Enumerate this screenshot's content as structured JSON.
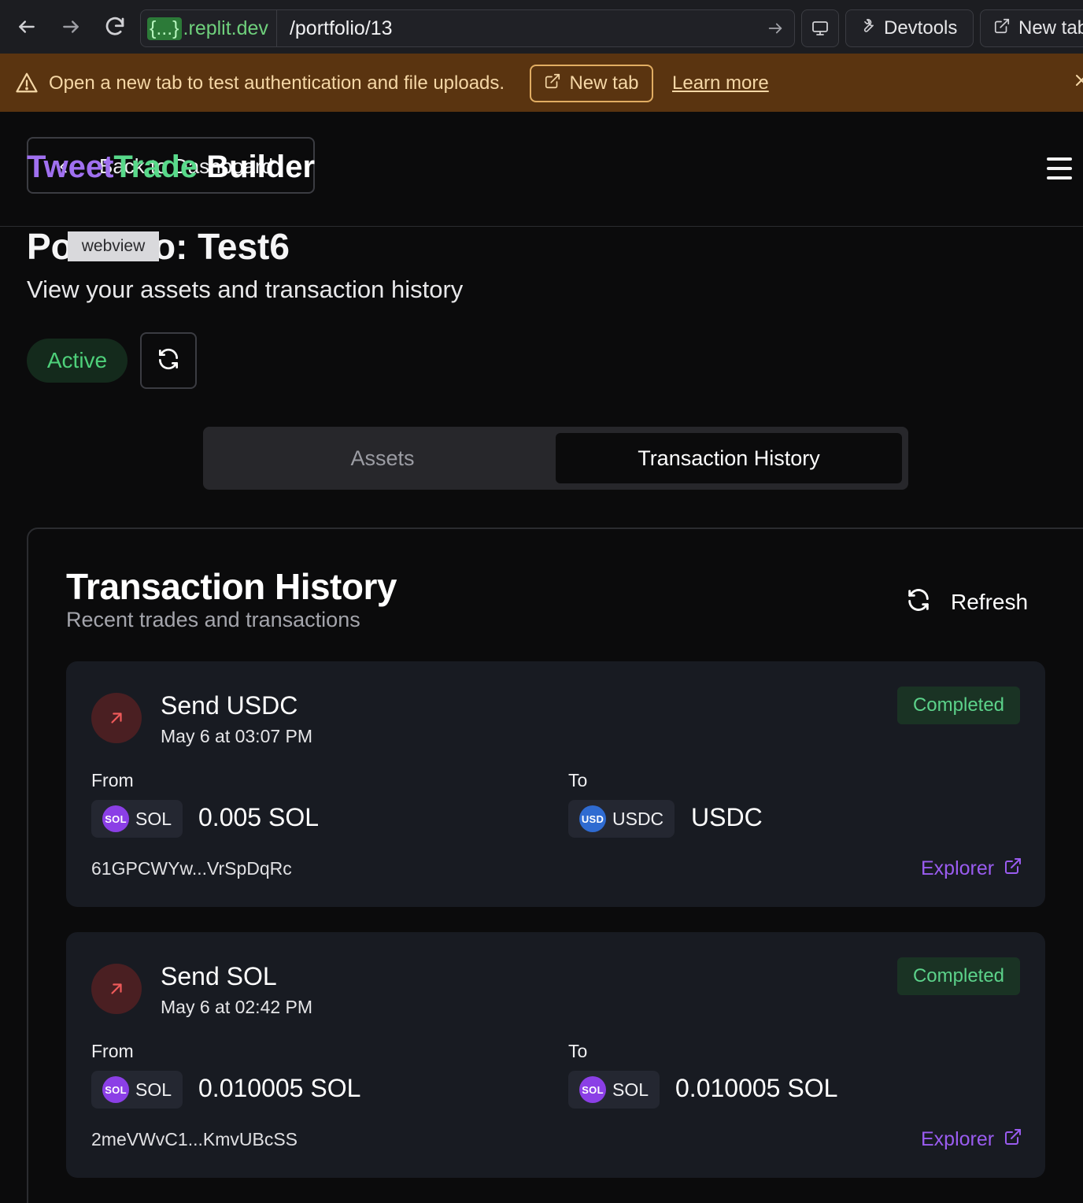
{
  "browser": {
    "domain_brace": "{...}",
    "domain_host": ".replit.dev",
    "path": "/portfolio/13",
    "devtools_label": "Devtools",
    "new_tab_label": "New tab"
  },
  "banner": {
    "message": "Open a new tab to test authentication and file uploads.",
    "button_label": "New tab",
    "link_label": "Learn more"
  },
  "header": {
    "back_label": "Back to Dashboard",
    "brand_part1": "Tweet",
    "brand_part2": "Trade",
    "brand_part3": " Builder"
  },
  "page": {
    "title": "Portfolio: Test6",
    "webview_tag": "webview",
    "subtitle": "View your assets and transaction history",
    "status": "Active"
  },
  "tabs": [
    {
      "label": "Assets",
      "active": false
    },
    {
      "label": "Transaction History",
      "active": true
    }
  ],
  "history": {
    "title": "Transaction History",
    "subtitle": "Recent trades and transactions",
    "refresh_label": "Refresh",
    "from_label": "From",
    "to_label": "To",
    "explorer_label": "Explorer",
    "transactions": [
      {
        "title": "Send USDC",
        "date": "May 6 at 03:07 PM",
        "status": "Completed",
        "from_token": "SOL",
        "from_token_badge": "SOL",
        "from_amount": "0.005 SOL",
        "to_token": "USDC",
        "to_token_badge": "USD",
        "to_amount": "USDC",
        "hash": "61GPCWYw...VrSpDqRc"
      },
      {
        "title": "Send SOL",
        "date": "May 6 at 02:42 PM",
        "status": "Completed",
        "from_token": "SOL",
        "from_token_badge": "SOL",
        "from_amount": "0.010005 SOL",
        "to_token": "SOL",
        "to_token_badge": "SOL",
        "to_amount": "0.010005 SOL",
        "hash": "2meVWvC1...KmvUBcSS"
      }
    ]
  },
  "colors": {
    "accent_purple": "#9a5cf0",
    "brand_green": "#58d98a",
    "status_green": "#5cd28a",
    "banner_bg": "#5a3410",
    "send_icon_bg": "#4a1f22"
  },
  "icons": [
    "back-arrow-icon",
    "forward-arrow-icon",
    "reload-icon",
    "go-arrow-icon",
    "monitor-icon",
    "wrench-icon",
    "external-link-icon",
    "warning-icon",
    "close-icon",
    "chevron-left-icon",
    "hamburger-icon",
    "refresh-icon",
    "send-arrow-icon"
  ]
}
